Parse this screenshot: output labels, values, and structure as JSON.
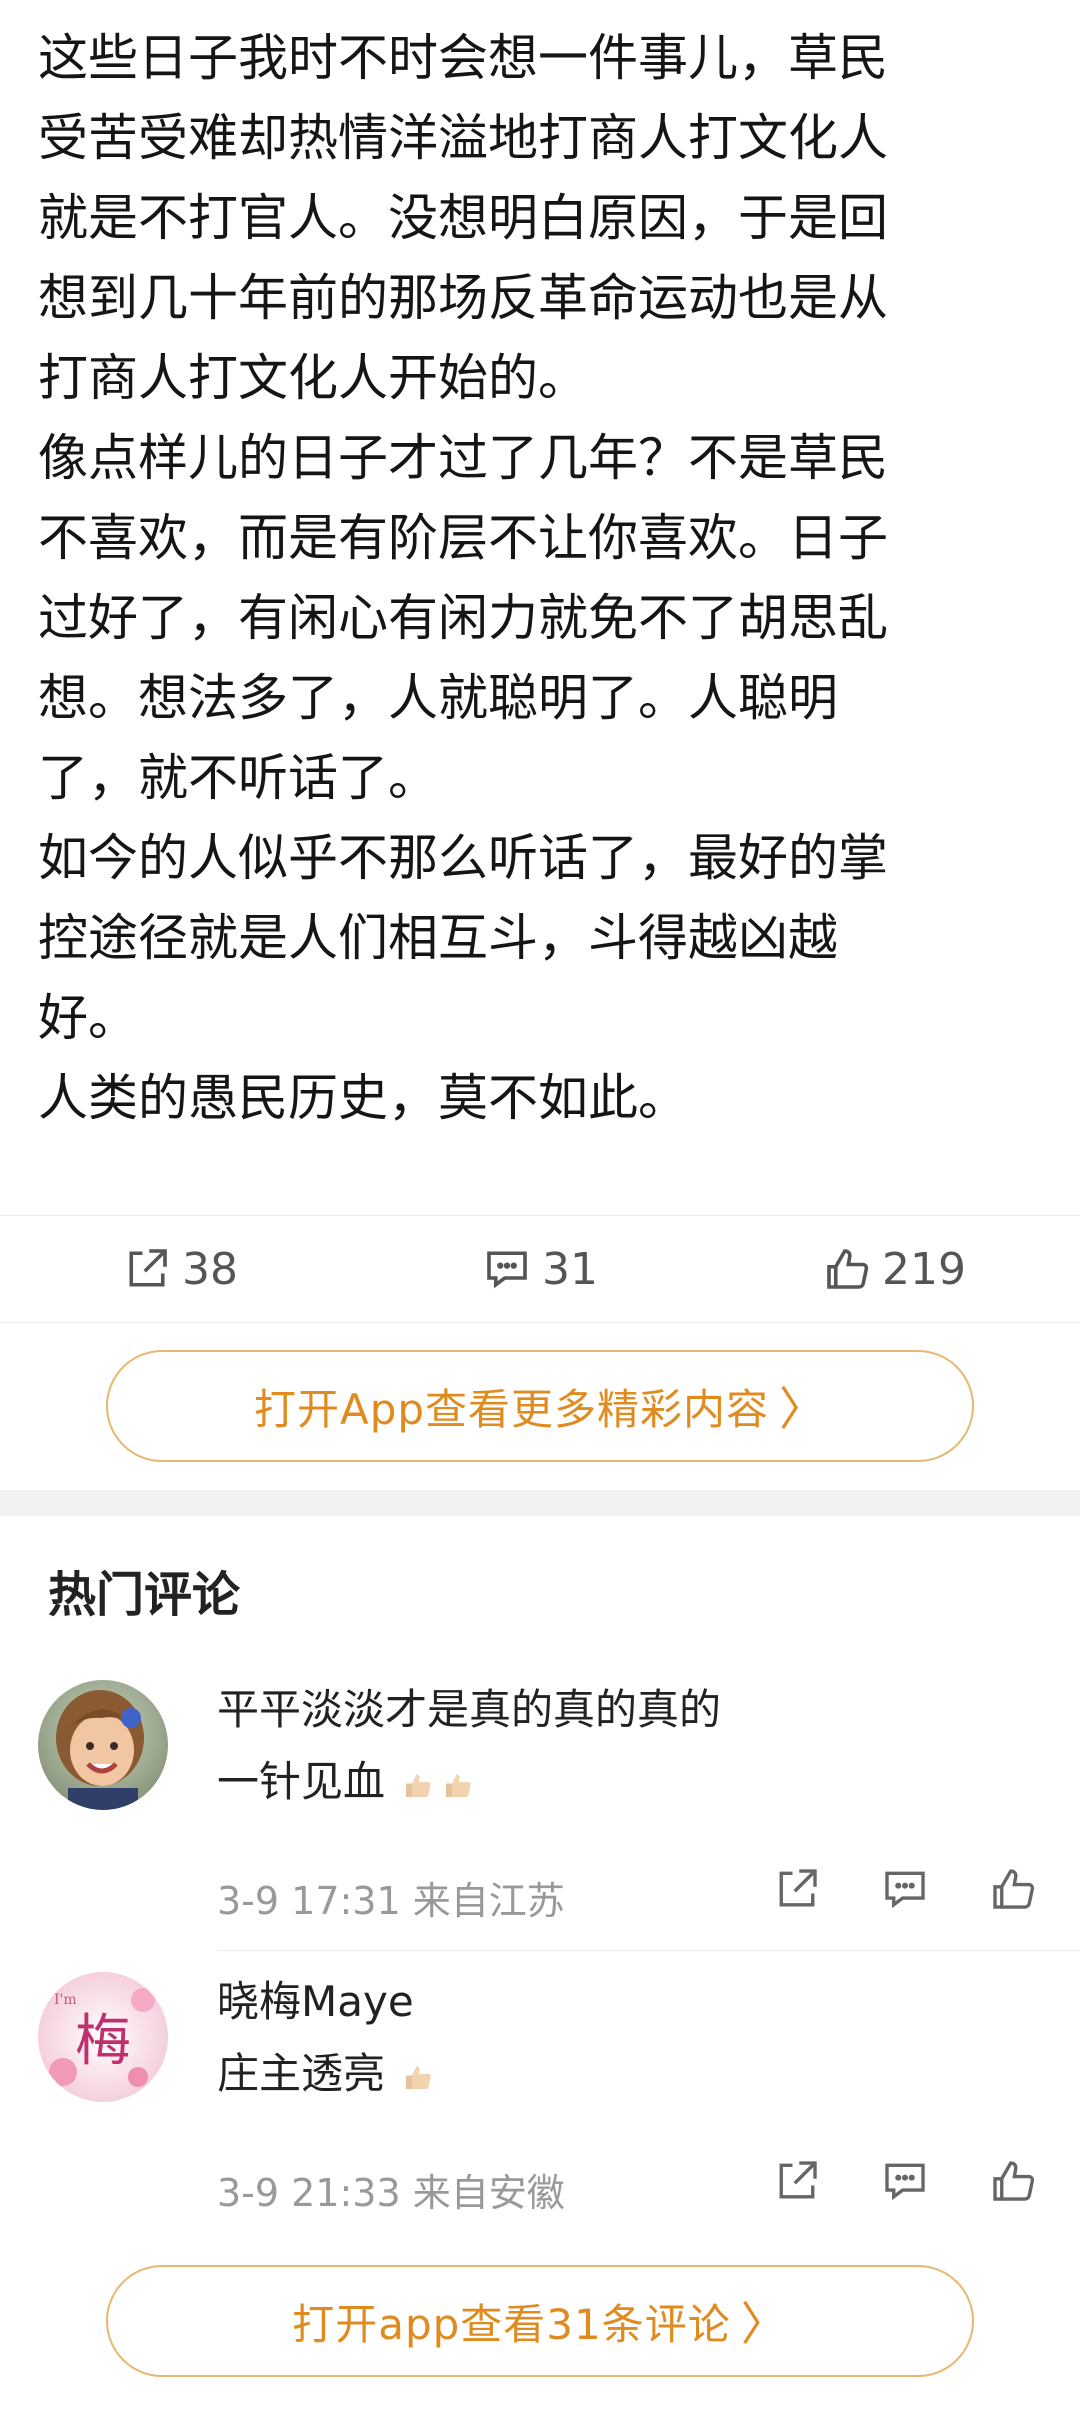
{
  "article": {
    "lines": [
      "这些日子我时不时会想一件事儿，草民",
      "受苦受难却热情洋溢地打商人打文化人",
      "就是不打官人。没想明白原因，于是回",
      "想到几十年前的那场反革命运动也是从",
      "打商人打文化人开始的。",
      "像点样儿的日子才过了几年？不是草民",
      "不喜欢，而是有阶层不让你喜欢。日子",
      "过好了，有闲心有闲力就免不了胡思乱",
      "想。想法多了，人就聪明了。人聪明",
      "了，就不听话了。",
      "如今的人似乎不那么听话了，最好的掌",
      "控途径就是人们相互斗，斗得越凶越",
      "好。",
      "人类的愚民历史，莫不如此。"
    ]
  },
  "actions": {
    "share_count": "38",
    "comment_count": "31",
    "like_count": "219"
  },
  "open_app_more": {
    "label": "打开App查看更多精彩内容",
    "chevron": "〉"
  },
  "hot_comments": {
    "title": "热门评论",
    "items": [
      {
        "author_line": "平平淡淡才是真的真的真的",
        "text": "一针见血",
        "meta": "3-9 17:31 来自江苏"
      },
      {
        "author_line": "晓梅Maye",
        "text": "庄主透亮",
        "meta": "3-9 21:33 来自安徽",
        "avatar_text": "梅",
        "avatar_small": "I'm"
      }
    ]
  },
  "open_app_comments": {
    "label": "打开app查看31条评论",
    "chevron": "〉"
  },
  "colors": {
    "accent": "#e08b1f",
    "border_accent": "#e6b871",
    "meta": "#999999"
  }
}
